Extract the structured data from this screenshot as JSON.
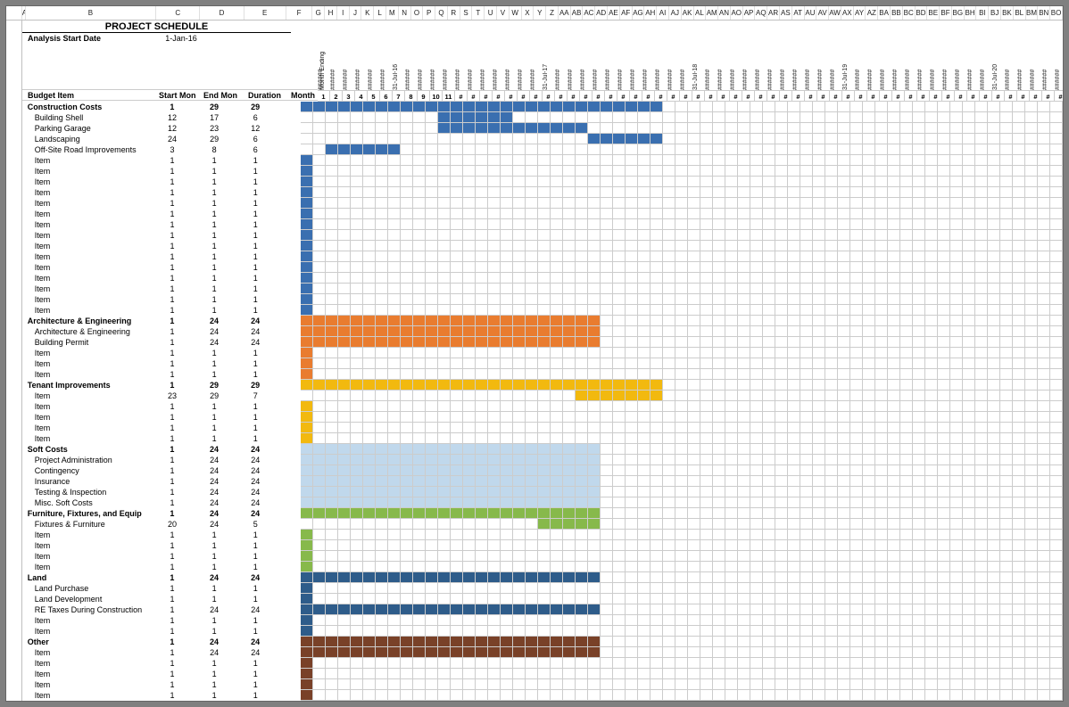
{
  "title": "PROJECT SCHEDULE",
  "analysis_label": "Analysis Start Date",
  "analysis_date": "1-Jan-16",
  "month_ending_label": "Month Ending",
  "headers": {
    "budget_item": "Budget Item",
    "start_mon": "Start Mon",
    "end_mon": "End Mon",
    "duration": "Duration",
    "month": "Month"
  },
  "col_letters_wide": [
    "A",
    "B",
    "C",
    "D",
    "E",
    "F"
  ],
  "col_letters_narrow": [
    "G",
    "H",
    "I",
    "J",
    "K",
    "L",
    "M",
    "N",
    "O",
    "P",
    "Q",
    "R",
    "S",
    "T",
    "U",
    "V",
    "W",
    "X",
    "Y",
    "Z",
    "AA",
    "AB",
    "AC",
    "AD",
    "AE",
    "AF",
    "AG",
    "AH",
    "AI",
    "AJ",
    "AK",
    "AL",
    "AM",
    "AN",
    "AO",
    "AP",
    "AQ",
    "AR",
    "AS",
    "AT",
    "AU",
    "AV",
    "AW",
    "AX",
    "AY",
    "AZ",
    "BA",
    "BB",
    "BC",
    "BD",
    "BE",
    "BF",
    "BG",
    "BH",
    "BI",
    "BJ",
    "BK",
    "BL",
    "BM",
    "BN",
    "BO"
  ],
  "month_headers": [
    "######",
    "######",
    "######",
    "######",
    "######",
    "######",
    "31-Jul-16",
    "######",
    "######",
    "######",
    "######",
    "######",
    "######",
    "######",
    "######",
    "######",
    "######",
    "######",
    "31-Jul-17",
    "######",
    "######",
    "######",
    "######",
    "######",
    "######",
    "######",
    "######",
    "######",
    "######",
    "######",
    "31-Jul-18",
    "######",
    "######",
    "######",
    "######",
    "######",
    "######",
    "######",
    "######",
    "######",
    "######",
    "######",
    "31-Jul-19",
    "######",
    "######",
    "######",
    "######",
    "######",
    "######",
    "######",
    "######",
    "######",
    "######",
    "######",
    "31-Jul-20",
    "######",
    "######",
    "######",
    "######",
    "######",
    "######"
  ],
  "month_nums": [
    "1",
    "2",
    "3",
    "4",
    "5",
    "6",
    "7",
    "8",
    "9",
    "10",
    "11",
    "#",
    "#",
    "#",
    "#",
    "#",
    "#",
    "#",
    "#",
    "#",
    "#",
    "#",
    "#",
    "#",
    "#",
    "#",
    "#",
    "#",
    "#",
    "#",
    "#",
    "#",
    "#",
    "#",
    "#",
    "#",
    "#",
    "#",
    "#",
    "#",
    "#",
    "#",
    "#",
    "#",
    "#",
    "#",
    "#",
    "#",
    "#",
    "#",
    "#",
    "#",
    "#",
    "#",
    "#",
    "#",
    "#",
    "#",
    "#",
    "#",
    "#"
  ],
  "rows": [
    {
      "label": "Construction Costs",
      "s": 1,
      "e": 29,
      "d": 29,
      "bold": true,
      "color": "f-blue",
      "start": 1,
      "len": 29
    },
    {
      "label": "Building Shell",
      "s": 12,
      "e": 17,
      "d": 6,
      "indent": true,
      "color": "f-blue",
      "start": 12,
      "len": 6
    },
    {
      "label": "Parking Garage",
      "s": 12,
      "e": 23,
      "d": 12,
      "indent": true,
      "color": "f-blue",
      "start": 12,
      "len": 12
    },
    {
      "label": "Landscaping",
      "s": 24,
      "e": 29,
      "d": 6,
      "indent": true,
      "color": "f-blue",
      "start": 24,
      "len": 6
    },
    {
      "label": "Off-Site Road Improvements",
      "s": 3,
      "e": 8,
      "d": 6,
      "indent": true,
      "color": "f-blue",
      "start": 3,
      "len": 6
    },
    {
      "label": "Item",
      "s": 1,
      "e": 1,
      "d": 1,
      "indent": true,
      "color": "f-blue",
      "start": 1,
      "len": 1
    },
    {
      "label": "Item",
      "s": 1,
      "e": 1,
      "d": 1,
      "indent": true,
      "color": "f-blue",
      "start": 1,
      "len": 1
    },
    {
      "label": "Item",
      "s": 1,
      "e": 1,
      "d": 1,
      "indent": true,
      "color": "f-blue",
      "start": 1,
      "len": 1
    },
    {
      "label": "Item",
      "s": 1,
      "e": 1,
      "d": 1,
      "indent": true,
      "color": "f-blue",
      "start": 1,
      "len": 1
    },
    {
      "label": "Item",
      "s": 1,
      "e": 1,
      "d": 1,
      "indent": true,
      "color": "f-blue",
      "start": 1,
      "len": 1
    },
    {
      "label": "Item",
      "s": 1,
      "e": 1,
      "d": 1,
      "indent": true,
      "color": "f-blue",
      "start": 1,
      "len": 1
    },
    {
      "label": "Item",
      "s": 1,
      "e": 1,
      "d": 1,
      "indent": true,
      "color": "f-blue",
      "start": 1,
      "len": 1
    },
    {
      "label": "Item",
      "s": 1,
      "e": 1,
      "d": 1,
      "indent": true,
      "color": "f-blue",
      "start": 1,
      "len": 1
    },
    {
      "label": "Item",
      "s": 1,
      "e": 1,
      "d": 1,
      "indent": true,
      "color": "f-blue",
      "start": 1,
      "len": 1
    },
    {
      "label": "Item",
      "s": 1,
      "e": 1,
      "d": 1,
      "indent": true,
      "color": "f-blue",
      "start": 1,
      "len": 1
    },
    {
      "label": "Item",
      "s": 1,
      "e": 1,
      "d": 1,
      "indent": true,
      "color": "f-blue",
      "start": 1,
      "len": 1
    },
    {
      "label": "Item",
      "s": 1,
      "e": 1,
      "d": 1,
      "indent": true,
      "color": "f-blue",
      "start": 1,
      "len": 1
    },
    {
      "label": "Item",
      "s": 1,
      "e": 1,
      "d": 1,
      "indent": true,
      "color": "f-blue",
      "start": 1,
      "len": 1
    },
    {
      "label": "Item",
      "s": 1,
      "e": 1,
      "d": 1,
      "indent": true,
      "color": "f-blue",
      "start": 1,
      "len": 1
    },
    {
      "label": "Item",
      "s": 1,
      "e": 1,
      "d": 1,
      "indent": true,
      "color": "f-blue",
      "start": 1,
      "len": 1
    },
    {
      "label": "Architecture & Engineering",
      "s": 1,
      "e": 24,
      "d": 24,
      "bold": true,
      "color": "f-orange",
      "start": 1,
      "len": 24
    },
    {
      "label": "Architecture & Engineering",
      "s": 1,
      "e": 24,
      "d": 24,
      "indent": true,
      "color": "f-orange",
      "start": 1,
      "len": 24
    },
    {
      "label": "Building Permit",
      "s": 1,
      "e": 24,
      "d": 24,
      "indent": true,
      "color": "f-orange",
      "start": 1,
      "len": 24
    },
    {
      "label": "Item",
      "s": 1,
      "e": 1,
      "d": 1,
      "indent": true,
      "color": "f-orange",
      "start": 1,
      "len": 1
    },
    {
      "label": "Item",
      "s": 1,
      "e": 1,
      "d": 1,
      "indent": true,
      "color": "f-orange",
      "start": 1,
      "len": 1
    },
    {
      "label": "Item",
      "s": 1,
      "e": 1,
      "d": 1,
      "indent": true,
      "color": "f-orange",
      "start": 1,
      "len": 1
    },
    {
      "label": "Tenant Improvements",
      "s": 1,
      "e": 29,
      "d": 29,
      "bold": true,
      "color": "f-gold",
      "start": 1,
      "len": 29
    },
    {
      "label": "Item",
      "s": 23,
      "e": 29,
      "d": 7,
      "indent": true,
      "color": "f-gold",
      "start": 23,
      "len": 7
    },
    {
      "label": "Item",
      "s": 1,
      "e": 1,
      "d": 1,
      "indent": true,
      "color": "f-gold",
      "start": 1,
      "len": 1
    },
    {
      "label": "Item",
      "s": 1,
      "e": 1,
      "d": 1,
      "indent": true,
      "color": "f-gold",
      "start": 1,
      "len": 1
    },
    {
      "label": "Item",
      "s": 1,
      "e": 1,
      "d": 1,
      "indent": true,
      "color": "f-gold",
      "start": 1,
      "len": 1
    },
    {
      "label": "Item",
      "s": 1,
      "e": 1,
      "d": 1,
      "indent": true,
      "color": "f-gold",
      "start": 1,
      "len": 1
    },
    {
      "label": "Soft Costs",
      "s": 1,
      "e": 24,
      "d": 24,
      "bold": true,
      "color": "f-lblue",
      "start": 1,
      "len": 24
    },
    {
      "label": "Project Administration",
      "s": 1,
      "e": 24,
      "d": 24,
      "indent": true,
      "color": "f-lblue",
      "start": 1,
      "len": 24
    },
    {
      "label": "Contingency",
      "s": 1,
      "e": 24,
      "d": 24,
      "indent": true,
      "color": "f-lblue",
      "start": 1,
      "len": 24
    },
    {
      "label": "Insurance",
      "s": 1,
      "e": 24,
      "d": 24,
      "indent": true,
      "color": "f-lblue",
      "start": 1,
      "len": 24
    },
    {
      "label": "Testing & Inspection",
      "s": 1,
      "e": 24,
      "d": 24,
      "indent": true,
      "color": "f-lblue",
      "start": 1,
      "len": 24
    },
    {
      "label": "Misc. Soft Costs",
      "s": 1,
      "e": 24,
      "d": 24,
      "indent": true,
      "color": "f-lblue",
      "start": 1,
      "len": 24
    },
    {
      "label": "Furniture, Fixtures, and Equip",
      "s": 1,
      "e": 24,
      "d": 24,
      "bold": true,
      "color": "f-green",
      "start": 1,
      "len": 24
    },
    {
      "label": "Fixtures & Furniture",
      "s": 20,
      "e": 24,
      "d": 5,
      "indent": true,
      "color": "f-green",
      "start": 20,
      "len": 5
    },
    {
      "label": "Item",
      "s": 1,
      "e": 1,
      "d": 1,
      "indent": true,
      "color": "f-green",
      "start": 1,
      "len": 1
    },
    {
      "label": "Item",
      "s": 1,
      "e": 1,
      "d": 1,
      "indent": true,
      "color": "f-green",
      "start": 1,
      "len": 1
    },
    {
      "label": "Item",
      "s": 1,
      "e": 1,
      "d": 1,
      "indent": true,
      "color": "f-green",
      "start": 1,
      "len": 1
    },
    {
      "label": "Item",
      "s": 1,
      "e": 1,
      "d": 1,
      "indent": true,
      "color": "f-green",
      "start": 1,
      "len": 1
    },
    {
      "label": "Land",
      "s": 1,
      "e": 24,
      "d": 24,
      "bold": true,
      "color": "f-blued",
      "start": 1,
      "len": 24
    },
    {
      "label": "Land Purchase",
      "s": 1,
      "e": 1,
      "d": 1,
      "indent": true,
      "color": "f-blued",
      "start": 1,
      "len": 1
    },
    {
      "label": "Land Development",
      "s": 1,
      "e": 1,
      "d": 1,
      "indent": true,
      "color": "f-blued",
      "start": 1,
      "len": 1
    },
    {
      "label": "RE Taxes During Construction",
      "s": 1,
      "e": 24,
      "d": 24,
      "indent": true,
      "color": "f-blued",
      "start": 1,
      "len": 24
    },
    {
      "label": "Item",
      "s": 1,
      "e": 1,
      "d": 1,
      "indent": true,
      "color": "f-blued",
      "start": 1,
      "len": 1
    },
    {
      "label": "Item",
      "s": 1,
      "e": 1,
      "d": 1,
      "indent": true,
      "color": "f-blued",
      "start": 1,
      "len": 1
    },
    {
      "label": "Other",
      "s": 1,
      "e": 24,
      "d": 24,
      "bold": true,
      "color": "f-brown",
      "start": 1,
      "len": 24
    },
    {
      "label": "Item",
      "s": 1,
      "e": 24,
      "d": 24,
      "indent": true,
      "color": "f-brown",
      "start": 1,
      "len": 24
    },
    {
      "label": "Item",
      "s": 1,
      "e": 1,
      "d": 1,
      "indent": true,
      "color": "f-brown",
      "start": 1,
      "len": 1
    },
    {
      "label": "Item",
      "s": 1,
      "e": 1,
      "d": 1,
      "indent": true,
      "color": "f-brown",
      "start": 1,
      "len": 1
    },
    {
      "label": "Item",
      "s": 1,
      "e": 1,
      "d": 1,
      "indent": true,
      "color": "f-brown",
      "start": 1,
      "len": 1
    },
    {
      "label": "Item",
      "s": 1,
      "e": 1,
      "d": 1,
      "indent": true,
      "color": "f-brown",
      "start": 1,
      "len": 1
    }
  ],
  "chart_data": {
    "type": "gantt",
    "title": "PROJECT SCHEDULE",
    "start_date": "1-Jan-16",
    "x_unit": "month",
    "x_range": [
      1,
      61
    ],
    "tasks": [
      {
        "name": "Construction Costs",
        "start": 1,
        "end": 29,
        "category": "Construction"
      },
      {
        "name": "Building Shell",
        "start": 12,
        "end": 17,
        "category": "Construction"
      },
      {
        "name": "Parking Garage",
        "start": 12,
        "end": 23,
        "category": "Construction"
      },
      {
        "name": "Landscaping",
        "start": 24,
        "end": 29,
        "category": "Construction"
      },
      {
        "name": "Off-Site Road Improvements",
        "start": 3,
        "end": 8,
        "category": "Construction"
      },
      {
        "name": "Architecture & Engineering",
        "start": 1,
        "end": 24,
        "category": "A&E"
      },
      {
        "name": "Building Permit",
        "start": 1,
        "end": 24,
        "category": "A&E"
      },
      {
        "name": "Tenant Improvements",
        "start": 1,
        "end": 29,
        "category": "TI"
      },
      {
        "name": "Soft Costs",
        "start": 1,
        "end": 24,
        "category": "Soft"
      },
      {
        "name": "Project Administration",
        "start": 1,
        "end": 24,
        "category": "Soft"
      },
      {
        "name": "Contingency",
        "start": 1,
        "end": 24,
        "category": "Soft"
      },
      {
        "name": "Insurance",
        "start": 1,
        "end": 24,
        "category": "Soft"
      },
      {
        "name": "Testing & Inspection",
        "start": 1,
        "end": 24,
        "category": "Soft"
      },
      {
        "name": "Misc. Soft Costs",
        "start": 1,
        "end": 24,
        "category": "Soft"
      },
      {
        "name": "Furniture, Fixtures, and Equip",
        "start": 1,
        "end": 24,
        "category": "FFE"
      },
      {
        "name": "Fixtures & Furniture",
        "start": 20,
        "end": 24,
        "category": "FFE"
      },
      {
        "name": "Land",
        "start": 1,
        "end": 24,
        "category": "Land"
      },
      {
        "name": "Land Purchase",
        "start": 1,
        "end": 1,
        "category": "Land"
      },
      {
        "name": "Land Development",
        "start": 1,
        "end": 1,
        "category": "Land"
      },
      {
        "name": "RE Taxes During Construction",
        "start": 1,
        "end": 24,
        "category": "Land"
      },
      {
        "name": "Other",
        "start": 1,
        "end": 24,
        "category": "Other"
      }
    ]
  }
}
